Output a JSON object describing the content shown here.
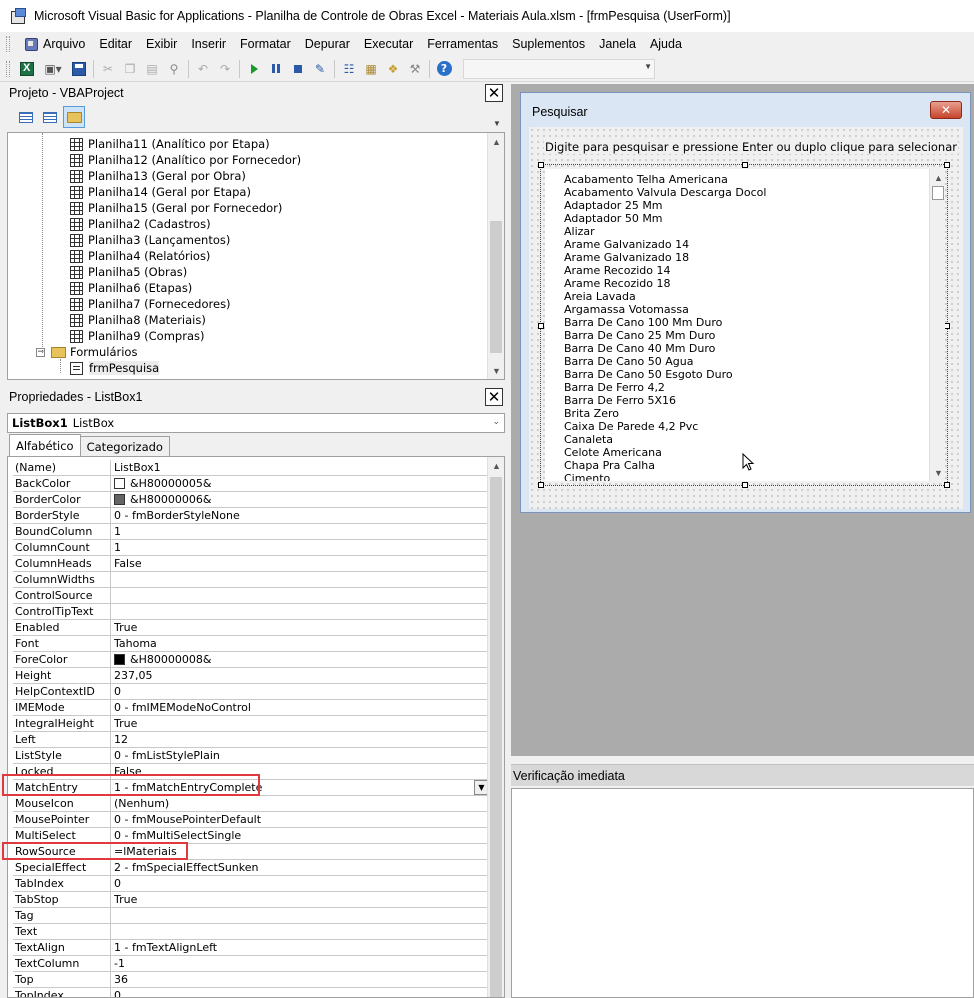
{
  "window": {
    "title": "Microsoft Visual Basic for Applications - Planilha de Controle de Obras Excel - Materiais Aula.xlsm - [frmPesquisa (UserForm)]"
  },
  "menu": {
    "items": [
      "Arquivo",
      "Editar",
      "Exibir",
      "Inserir",
      "Formatar",
      "Depurar",
      "Executar",
      "Ferramentas",
      "Suplementos",
      "Janela",
      "Ajuda"
    ]
  },
  "toolbar": {
    "icons": [
      "excel-icon",
      "insert-form-icon",
      "save-icon",
      "cut-icon",
      "copy-icon",
      "paste-icon",
      "find-icon",
      "undo-icon",
      "redo-icon",
      "run-icon",
      "break-icon",
      "reset-icon",
      "design-mode-icon",
      "project-explorer-icon",
      "properties-icon",
      "object-browser-icon",
      "toolbox-icon",
      "help-icon"
    ]
  },
  "project": {
    "title": "Projeto - VBAProject",
    "sheets": [
      "Planilha11 (Analítico por Etapa)",
      "Planilha12 (Analítico por Fornecedor)",
      "Planilha13 (Geral por Obra)",
      "Planilha14 (Geral por Etapa)",
      "Planilha15 (Geral por Fornecedor)",
      "Planilha2 (Cadastros)",
      "Planilha3 (Lançamentos)",
      "Planilha4 (Relatórios)",
      "Planilha5 (Obras)",
      "Planilha6 (Etapas)",
      "Planilha7 (Fornecedores)",
      "Planilha8 (Materiais)",
      "Planilha9 (Compras)"
    ],
    "forms_folder": "Formulários",
    "form_item": "frmPesquisa"
  },
  "properties": {
    "title": "Propriedades - ListBox1",
    "object_name": "ListBox1",
    "object_type": "ListBox",
    "tabs": [
      "Alfabético",
      "Categorizado"
    ],
    "rows": [
      {
        "name": "(Name)",
        "value": "ListBox1"
      },
      {
        "name": "BackColor",
        "value": "&H80000005&",
        "swatch": "#ffffff"
      },
      {
        "name": "BorderColor",
        "value": "&H80000006&",
        "swatch": "#646464"
      },
      {
        "name": "BorderStyle",
        "value": "0 - fmBorderStyleNone"
      },
      {
        "name": "BoundColumn",
        "value": "1"
      },
      {
        "name": "ColumnCount",
        "value": "1"
      },
      {
        "name": "ColumnHeads",
        "value": "False"
      },
      {
        "name": "ColumnWidths",
        "value": ""
      },
      {
        "name": "ControlSource",
        "value": ""
      },
      {
        "name": "ControlTipText",
        "value": ""
      },
      {
        "name": "Enabled",
        "value": "True"
      },
      {
        "name": "Font",
        "value": "Tahoma"
      },
      {
        "name": "ForeColor",
        "value": "&H80000008&",
        "swatch": "#000000"
      },
      {
        "name": "Height",
        "value": "237,05"
      },
      {
        "name": "HelpContextID",
        "value": "0"
      },
      {
        "name": "IMEMode",
        "value": "0 - fmIMEModeNoControl"
      },
      {
        "name": "IntegralHeight",
        "value": "True"
      },
      {
        "name": "Left",
        "value": "12"
      },
      {
        "name": "ListStyle",
        "value": "0 - fmListStylePlain"
      },
      {
        "name": "Locked",
        "value": "False"
      },
      {
        "name": "MatchEntry",
        "value": "1 - fmMatchEntryComplete"
      },
      {
        "name": "MouseIcon",
        "value": "(Nenhum)"
      },
      {
        "name": "MousePointer",
        "value": "0 - fmMousePointerDefault"
      },
      {
        "name": "MultiSelect",
        "value": "0 - fmMultiSelectSingle"
      },
      {
        "name": "RowSource",
        "value": "=lMateriais"
      },
      {
        "name": "SpecialEffect",
        "value": "2 - fmSpecialEffectSunken"
      },
      {
        "name": "TabIndex",
        "value": "0"
      },
      {
        "name": "TabStop",
        "value": "True"
      },
      {
        "name": "Tag",
        "value": ""
      },
      {
        "name": "Text",
        "value": ""
      },
      {
        "name": "TextAlign",
        "value": "1 - fmTextAlignLeft"
      },
      {
        "name": "TextColumn",
        "value": "-1"
      },
      {
        "name": "Top",
        "value": "36"
      },
      {
        "name": "TopIndex",
        "value": "0"
      }
    ]
  },
  "form": {
    "title": "Pesquisar",
    "close_label": "✕",
    "label": "Digite para pesquisar e pressione Enter ou duplo clique para selecionar",
    "list_items": [
      "Acabamento Telha Americana",
      "Acabamento Valvula Descarga Docol",
      "Adaptador 25 Mm",
      "Adaptador 50 Mm",
      "Alizar",
      "Arame Galvanizado 14",
      "Arame Galvanizado 18",
      "Arame Recozido 14",
      "Arame Recozido 18",
      "Areia Lavada",
      "Argamassa Votomassa",
      "Barra De Cano 100 Mm Duro",
      "Barra De Cano 25 Mm Duro",
      "Barra De Cano 40 Mm Duro",
      "Barra De Cano 50 Agua",
      "Barra De Cano 50 Esgoto Duro",
      "Barra De Ferro 4,2",
      "Barra De Ferro 5X16",
      "Brita Zero",
      "Caixa De Parede 4,2 Pvc",
      "Canaleta",
      "Celote Americana",
      "Chapa Pra Calha",
      "Cimento"
    ]
  },
  "immediate": {
    "title": "Verificação imediata"
  }
}
